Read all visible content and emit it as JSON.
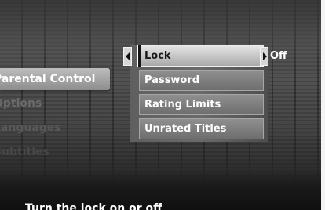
{
  "left_menu": {
    "items": [
      {
        "label": "Parental Control",
        "selected": true
      },
      {
        "label": "Options",
        "selected": false
      },
      {
        "label": "Languages",
        "selected": false
      },
      {
        "label": "Subtitles",
        "selected": false
      }
    ]
  },
  "submenu": {
    "items": [
      {
        "label": "Lock",
        "selected": true,
        "value": "Off"
      },
      {
        "label": "Password",
        "selected": false
      },
      {
        "label": "Rating Limits",
        "selected": false
      },
      {
        "label": "Unrated Titles",
        "selected": false
      }
    ]
  },
  "help_text": "Turn the lock on or off",
  "icons": {
    "value_prev": "left-arrow-icon",
    "value_next": "right-arrow-icon"
  }
}
